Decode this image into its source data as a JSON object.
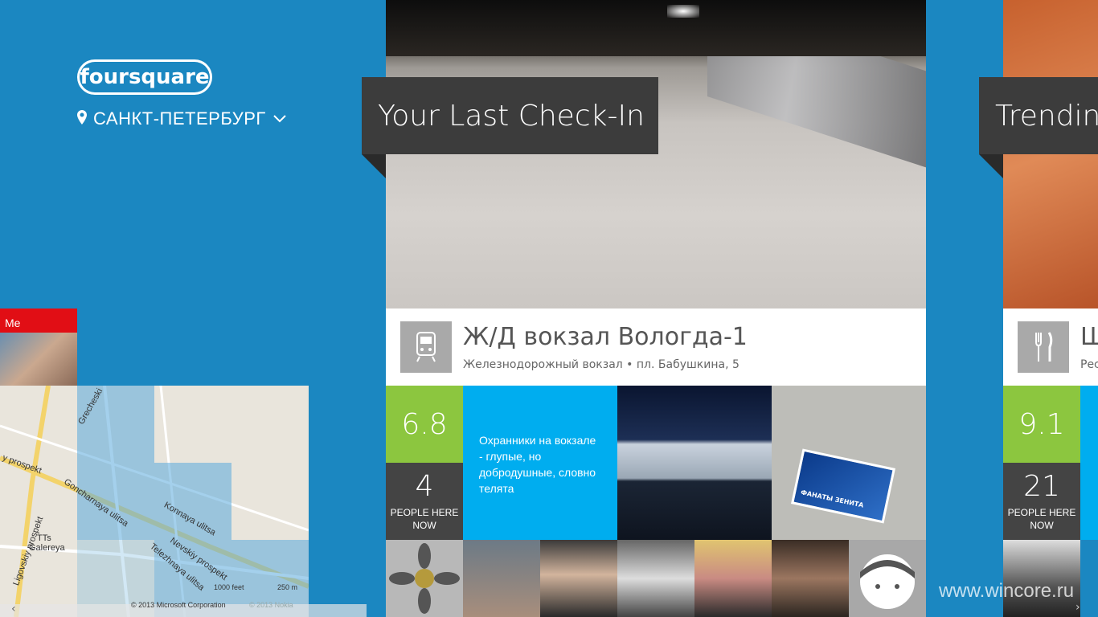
{
  "app": {
    "logo_text": "foursquare"
  },
  "location": {
    "city": "САНКТ-ПЕТЕРБУРГ",
    "pin_icon": "location-pin-icon",
    "dropdown_icon": "chevron-down-icon"
  },
  "map": {
    "me_label": "Me",
    "street_labels": [
      "y prospekt",
      "Goncharnaya ulitsa",
      "Ligovskiy prospekt",
      "Nevskiy prospekt",
      "Konnaya ulitsa",
      "Telezhnaya ulitsa",
      "Grecheski",
      "TTs",
      "Galereya"
    ],
    "scale_feet": "1000 feet",
    "scale_m": "250 m",
    "copyright": "© 2013 Microsoft Corporation",
    "copyright2": "© 2013 Nokia"
  },
  "last_checkin": {
    "title": "Your Last Check-In",
    "venue_name": "Ж/Д вокзал Вологда-1",
    "venue_category_address": "Железнодорожный вокзал • пл. Бабушкина, 5",
    "venue_icon": "train-icon",
    "score": "6.8",
    "people_count": "4",
    "people_label": "PEOPLE HERE NOW",
    "tip": "Охранники на вокзале - глупые, но добродушные, словно телята",
    "photo_tiles": [
      "station-photo",
      "wall-sticker-photo"
    ],
    "sticker_text": "ФАНАТЫ ЗЕНИТА"
  },
  "trending": {
    "title": "Trending",
    "venue_name": "Щ",
    "venue_sub": "Рес",
    "venue_icon": "fork-knife-icon",
    "score": "9.1",
    "people_count": "21",
    "people_label": "PEOPLE HERE NOW"
  },
  "watermark": "www.wincore.ru",
  "colors": {
    "background": "#1b87c1",
    "score_green": "#8cc63f",
    "tip_blue": "#00adef",
    "banner": "#3c3c3c",
    "me_red": "#e10e15"
  }
}
